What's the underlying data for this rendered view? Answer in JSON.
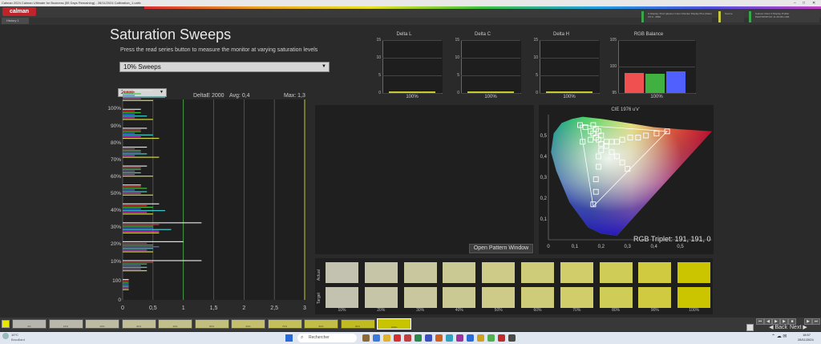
{
  "window": {
    "title": "Calman 2024 Calman Ultimate for Business (55 Days Remaining) - 28/11/2024 Calibration_1.calfx",
    "controls": [
      "–",
      "□",
      "✕"
    ]
  },
  "app": {
    "logo_text": "calman"
  },
  "tabs": [
    {
      "label": "History 1"
    }
  ],
  "devices": [
    {
      "line1": "G Display: Prod (planner Color-Checker Display Plus (Meter)",
      "line2": "CX:0 - 2560"
    },
    {
      "line1": "Source",
      "line2": ""
    },
    {
      "line1": "Calman Client 3 Display Profiler",
      "line2": "PHATOPINTUO 11 46 DFU 206"
    }
  ],
  "page": {
    "title": "Saturation Sweeps",
    "subtitle": "Press the read series button to measure the monitor at varying saturation levels",
    "sweep_select": "10% Sweeps",
    "scale_select": "2000",
    "open_pattern_button": "Open Pattern Window"
  },
  "deltaE_stats": {
    "label": "DeltaE 2000",
    "avg": "Avg: 0,4",
    "max": "Max: 1,3"
  },
  "chart_data": [
    {
      "type": "bar",
      "orientation": "horizontal",
      "title": "DeltaE 2000",
      "categories": [
        "0",
        "10%",
        "20%",
        "30%",
        "40%",
        "50%",
        "60%",
        "70%",
        "80%",
        "90%",
        "100%"
      ],
      "y_tick_labels": [
        "0",
        "100",
        "10%",
        "20%",
        "30%",
        "40%",
        "50%",
        "60%",
        "70%",
        "80%",
        "90%",
        "100%"
      ],
      "x_tick_labels": [
        "0",
        "0,5",
        "1",
        "1,5",
        "2",
        "2,5",
        "3"
      ],
      "xlim": [
        0,
        3
      ],
      "series": [
        {
          "color": "#e0e0e0",
          "values": [
            0.1,
            1.3,
            1.0,
            1.3,
            0.6,
            0.3,
            0.4,
            0.4,
            0.4,
            0.3,
            0.5
          ]
        },
        {
          "color": "#d04040",
          "values": [
            0.1,
            0.5,
            0.4,
            0.6,
            0.4,
            0.3,
            0.3,
            0.2,
            0.3,
            0.2,
            0.2
          ]
        },
        {
          "color": "#40c040",
          "values": [
            0.1,
            0.4,
            0.5,
            0.5,
            0.5,
            0.4,
            0.3,
            0.3,
            0.3,
            0.3,
            0.3
          ]
        },
        {
          "color": "#5070e0",
          "values": [
            0.1,
            0.3,
            0.6,
            0.5,
            0.3,
            0.2,
            0.2,
            0.3,
            0.2,
            0.2,
            0.2
          ]
        },
        {
          "color": "#40d0d0",
          "values": [
            0.1,
            0.4,
            0.5,
            0.8,
            0.7,
            0.4,
            0.3,
            0.4,
            0.5,
            0.4,
            0.7
          ]
        },
        {
          "color": "#d040d0",
          "values": [
            0.1,
            0.3,
            0.4,
            0.6,
            0.4,
            0.3,
            0.2,
            0.2,
            0.3,
            0.2,
            0.3
          ]
        },
        {
          "color": "#d8d840",
          "values": [
            0.1,
            0.4,
            0.5,
            0.6,
            0.5,
            0.5,
            0.5,
            0.6,
            0.6,
            0.5,
            0.5
          ]
        }
      ],
      "reference_lines": [
        {
          "x": 1,
          "color": "#40a040"
        },
        {
          "x": 3,
          "color": "#c8c840"
        }
      ]
    },
    {
      "type": "bar",
      "title": "Delta L",
      "categories": [
        "100%"
      ],
      "values": [
        0.3
      ],
      "ylim": [
        0,
        15
      ],
      "y_tick_labels": [
        "0",
        "5",
        "10",
        "15"
      ],
      "color": "#c8c830"
    },
    {
      "type": "bar",
      "title": "Delta C",
      "categories": [
        "100%"
      ],
      "values": [
        0.3
      ],
      "ylim": [
        0,
        15
      ],
      "y_tick_labels": [
        "0",
        "5",
        "10",
        "15"
      ],
      "color": "#c8c830"
    },
    {
      "type": "bar",
      "title": "Delta H",
      "categories": [
        "100%"
      ],
      "values": [
        0.2
      ],
      "ylim": [
        0,
        15
      ],
      "y_tick_labels": [
        "0",
        "5",
        "10",
        "15"
      ],
      "color": "#c8c830"
    },
    {
      "type": "bar",
      "title": "RGB Balance",
      "categories": [
        "100%"
      ],
      "series": [
        {
          "color": "#f05050",
          "values": [
            98.8
          ]
        },
        {
          "color": "#40b040",
          "values": [
            98.6
          ]
        },
        {
          "color": "#5060ff",
          "values": [
            99.1
          ]
        }
      ],
      "ylim": [
        95,
        105
      ],
      "y_tick_labels": [
        "95",
        "100",
        "105"
      ]
    },
    {
      "type": "scatter",
      "title": "CIE 1976 u'v'",
      "x_tick_labels": [
        "0",
        "0,1",
        "0,2",
        "0,3",
        "0,4",
        "0,5"
      ],
      "y_tick_labels": [
        "0,1",
        "0,2",
        "0,3",
        "0,4",
        "0,5"
      ],
      "xlim": [
        0,
        0.62
      ],
      "ylim": [
        0,
        0.6
      ],
      "annotation": "RGB Triplet: 191, 191, 0",
      "targets": [
        [
          0.45,
          0.52
        ],
        [
          0.41,
          0.51
        ],
        [
          0.37,
          0.5
        ],
        [
          0.34,
          0.49
        ],
        [
          0.31,
          0.49
        ],
        [
          0.28,
          0.48
        ],
        [
          0.26,
          0.47
        ],
        [
          0.24,
          0.47
        ],
        [
          0.22,
          0.47
        ],
        [
          0.12,
          0.55
        ],
        [
          0.14,
          0.54
        ],
        [
          0.16,
          0.52
        ],
        [
          0.17,
          0.51
        ],
        [
          0.18,
          0.49
        ],
        [
          0.19,
          0.48
        ],
        [
          0.17,
          0.55
        ],
        [
          0.18,
          0.53
        ],
        [
          0.19,
          0.52
        ],
        [
          0.2,
          0.5
        ],
        [
          0.2,
          0.46
        ],
        [
          0.2,
          0.43
        ],
        [
          0.19,
          0.4
        ],
        [
          0.19,
          0.35
        ],
        [
          0.18,
          0.29
        ],
        [
          0.18,
          0.23
        ],
        [
          0.17,
          0.17
        ],
        [
          0.22,
          0.45
        ],
        [
          0.24,
          0.42
        ],
        [
          0.26,
          0.4
        ],
        [
          0.28,
          0.37
        ],
        [
          0.3,
          0.34
        ],
        [
          0.16,
          0.48
        ],
        [
          0.13,
          0.47
        ]
      ]
    }
  ],
  "swatches": {
    "row_labels": [
      "Actual",
      "Target"
    ],
    "labels": [
      "10%",
      "20%",
      "30%",
      "40%",
      "50%",
      "60%",
      "70%",
      "80%",
      "90%",
      "100%"
    ],
    "colors": [
      "#c3c2b1",
      "#c6c5a8",
      "#c9c79e",
      "#cbc993",
      "#cdcb87",
      "#cfcc79",
      "#d0cd6a",
      "#d0cc58",
      "#cfca3f",
      "#cbc500"
    ]
  },
  "bottom_strip": {
    "labels": [
      "0%",
      "10%",
      "20%",
      "30%",
      "40%",
      "50%",
      "60%",
      "70%",
      "80%",
      "90%",
      "100%"
    ],
    "colors": [
      "#b5b5ae",
      "#b9b8aa",
      "#bdbba2",
      "#bfbe97",
      "#c1bf8a",
      "#c2bf7c",
      "#c3bf6c",
      "#c3bf5a",
      "#c2bd44",
      "#c0bb20",
      "#c8c400"
    ]
  },
  "navigation": {
    "back": "Back",
    "next": "Next"
  },
  "taskbar": {
    "search_placeholder": "Rechercher",
    "weather": "10°C",
    "weather_desc": "Brouillard",
    "time": "18:57",
    "date": "28/11/2024"
  }
}
